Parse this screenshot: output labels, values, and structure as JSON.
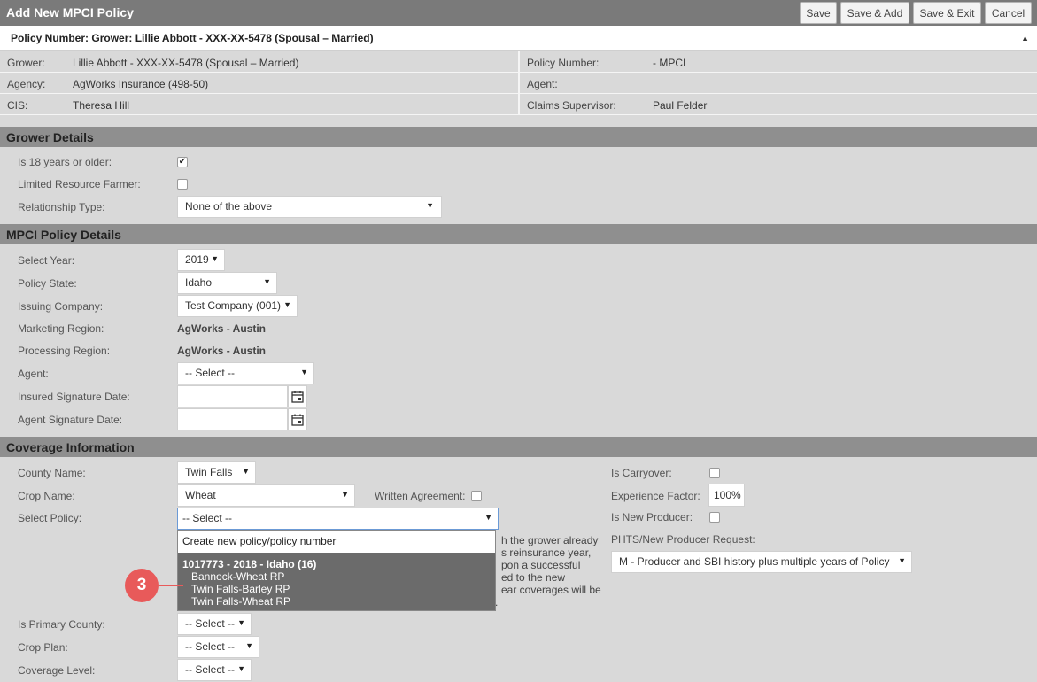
{
  "window": {
    "title": "Add New MPCI Policy",
    "buttons": {
      "save": "Save",
      "save_add": "Save & Add",
      "save_exit": "Save & Exit",
      "cancel": "Cancel"
    }
  },
  "policy_header": "Policy Number: Grower: Lillie Abbott - XXX-XX-5478 (Spousal – Married)",
  "info": {
    "grower_label": "Grower:",
    "grower_value": "Lillie Abbott - XXX-XX-5478 (Spousal – Married)",
    "agency_label": "Agency:",
    "agency_value": "AgWorks Insurance (498-50)",
    "cis_label": "CIS:",
    "cis_value": "Theresa Hill",
    "policy_number_label": "Policy Number:",
    "policy_number_value": "- MPCI",
    "agent_label": "Agent:",
    "agent_value": "",
    "claims_supervisor_label": "Claims Supervisor:",
    "claims_supervisor_value": "Paul Felder"
  },
  "grower_details": {
    "heading": "Grower Details",
    "age_label": "Is 18 years or older:",
    "age_checked": true,
    "limited_label": "Limited Resource Farmer:",
    "limited_checked": false,
    "relationship_label": "Relationship Type:",
    "relationship_value": "None of the above"
  },
  "mpci_details": {
    "heading": "MPCI Policy Details",
    "year_label": "Select Year:",
    "year_value": "2019",
    "state_label": "Policy State:",
    "state_value": "Idaho",
    "company_label": "Issuing Company:",
    "company_value": "Test Company (001)",
    "marketing_label": "Marketing Region:",
    "marketing_value": "AgWorks - Austin",
    "processing_label": "Processing Region:",
    "processing_value": "AgWorks - Austin",
    "agent_label": "Agent:",
    "agent_value": "-- Select --",
    "insured_sig_label": "Insured Signature Date:",
    "agent_sig_label": "Agent Signature Date:"
  },
  "coverage": {
    "heading": "Coverage Information",
    "county_label": "County Name:",
    "county_value": "Twin Falls",
    "crop_label": "Crop Name:",
    "crop_value": "Wheat",
    "written_label": "Written Agreement:",
    "select_policy_label": "Select Policy:",
    "select_policy_value": "-- Select --",
    "primary_county_label": "Is Primary County:",
    "primary_county_value": "-- Select --",
    "crop_plan_label": "Crop Plan:",
    "crop_plan_value": "-- Select --",
    "coverage_level_label": "Coverage Level:",
    "coverage_level_value": "-- Select --",
    "carryover_label": "Is Carryover:",
    "experience_label": "Experience Factor:",
    "experience_value": "100%",
    "new_producer_label": "Is New Producer:",
    "phts_label": "PHTS/New Producer Request:",
    "phts_value": "M - Producer and SBI history plus multiple years of Policy H",
    "help_fragments": [
      "h the grower already",
      "s reinsurance year,",
      "pon a successful",
      "ed to the new",
      "ear coverages will be",
      "."
    ]
  },
  "dropdown": {
    "create_option": "Create new policy/policy number",
    "group_title": "1017773 - 2018 - Idaho (16)",
    "options": [
      "Bannock-Wheat RP",
      "Twin Falls-Barley RP",
      "Twin Falls-Wheat RP"
    ]
  },
  "callout_number": "3"
}
